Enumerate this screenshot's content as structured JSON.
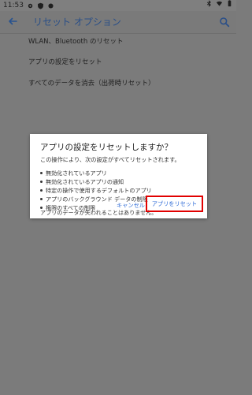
{
  "status_bar": {
    "time": "11:53"
  },
  "app_bar": {
    "title": "リセット オプション"
  },
  "settings": {
    "items": [
      "WLAN、Bluetooth のリセット",
      "アプリの設定をリセット",
      "すべてのデータを消去（出荷時リセット）"
    ]
  },
  "dialog": {
    "title": "アプリの設定をリセットしますか？",
    "description": "この操作により、次の設定がすべてリセットされます。",
    "bullets": [
      "無効化されているアプリ",
      "無効化されているアプリの通知",
      "特定の操作で使用するデフォルトのアプリ",
      "アプリのバックグラウンド データの制限",
      "権限のすべての制限"
    ],
    "note": "アプリのデータが失われることはありません。",
    "buttons": {
      "cancel": "キャンセル",
      "reset": "アプリをリセット"
    }
  },
  "colors": {
    "overlay": "#7b7b7b",
    "dialog_bg": "#ffffff",
    "accent": "#2e6bd7",
    "highlight": "#e10000"
  },
  "icons": {
    "back": "arrow-left-icon",
    "search": "search-icon"
  }
}
